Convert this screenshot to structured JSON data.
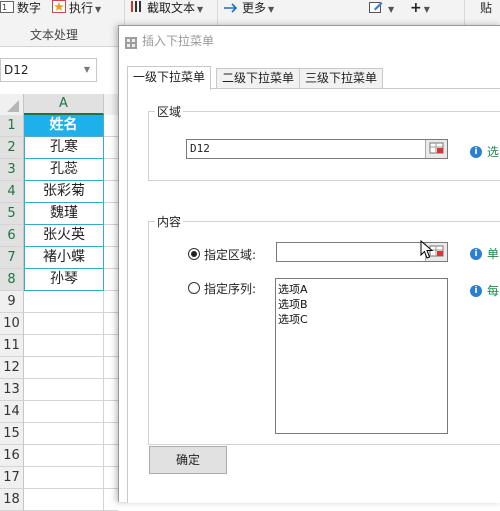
{
  "ribbon": {
    "items": [
      {
        "label": "数字"
      },
      {
        "label": "执行"
      },
      {
        "label": "截取文本"
      },
      {
        "label": "更多"
      },
      {
        "label": "+"
      },
      {
        "label": "贴"
      }
    ],
    "group_label": "文本处理"
  },
  "sheet": {
    "name_box": "D12",
    "column_header": "A",
    "rows": [
      {
        "num": "1",
        "value": "姓名"
      },
      {
        "num": "2",
        "value": "孔寒"
      },
      {
        "num": "3",
        "value": "孔蕊"
      },
      {
        "num": "4",
        "value": "张彩菊"
      },
      {
        "num": "5",
        "value": "魏瑾"
      },
      {
        "num": "6",
        "value": "张火英"
      },
      {
        "num": "7",
        "value": "褚小蝶"
      },
      {
        "num": "8",
        "value": "孙琴"
      },
      {
        "num": "9",
        "value": ""
      },
      {
        "num": "10",
        "value": ""
      },
      {
        "num": "11",
        "value": ""
      },
      {
        "num": "12",
        "value": ""
      },
      {
        "num": "13",
        "value": ""
      },
      {
        "num": "14",
        "value": ""
      },
      {
        "num": "15",
        "value": ""
      },
      {
        "num": "16",
        "value": ""
      },
      {
        "num": "17",
        "value": ""
      },
      {
        "num": "18",
        "value": ""
      }
    ]
  },
  "dialog": {
    "title": "插入下拉菜单",
    "tabs": [
      {
        "label": "一级下拉菜单"
      },
      {
        "label": "二级下拉菜单"
      },
      {
        "label": "三级下拉菜单"
      }
    ],
    "area_group": {
      "caption": "区域",
      "value": "D12",
      "hint": "选"
    },
    "content_group": {
      "caption": "内容",
      "option_range_label": "指定区域:",
      "option_range_value": "",
      "option_range_hint": "单",
      "option_sequence_label": "指定序列:",
      "sequence_text": "选项A\n选项B\n选项C",
      "sequence_hint": "每"
    },
    "ok_label": "确定"
  },
  "colors": {
    "header_fill": "#1eb0ea",
    "excel_green": "#217346",
    "hint_green": "#1a8a4a",
    "info_blue": "#2a7fd4"
  }
}
